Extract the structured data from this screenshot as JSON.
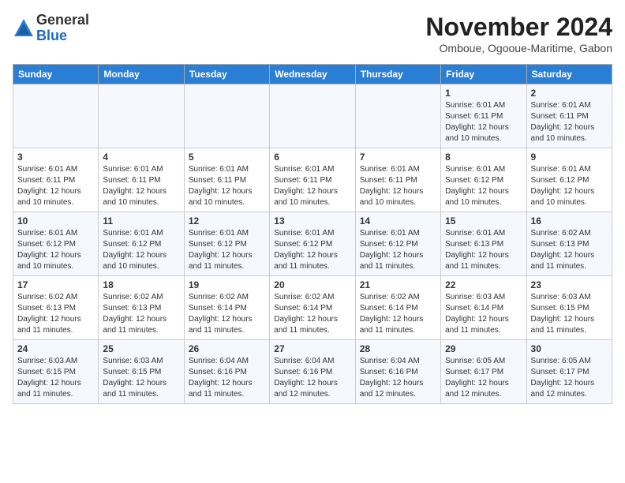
{
  "header": {
    "logo_line1": "General",
    "logo_line2": "Blue",
    "month_title": "November 2024",
    "subtitle": "Omboue, Ogooue-Maritime, Gabon"
  },
  "calendar": {
    "days_of_week": [
      "Sunday",
      "Monday",
      "Tuesday",
      "Wednesday",
      "Thursday",
      "Friday",
      "Saturday"
    ],
    "weeks": [
      [
        {
          "day": "",
          "info": ""
        },
        {
          "day": "",
          "info": ""
        },
        {
          "day": "",
          "info": ""
        },
        {
          "day": "",
          "info": ""
        },
        {
          "day": "",
          "info": ""
        },
        {
          "day": "1",
          "info": "Sunrise: 6:01 AM\nSunset: 6:11 PM\nDaylight: 12 hours\nand 10 minutes."
        },
        {
          "day": "2",
          "info": "Sunrise: 6:01 AM\nSunset: 6:11 PM\nDaylight: 12 hours\nand 10 minutes."
        }
      ],
      [
        {
          "day": "3",
          "info": "Sunrise: 6:01 AM\nSunset: 6:11 PM\nDaylight: 12 hours\nand 10 minutes."
        },
        {
          "day": "4",
          "info": "Sunrise: 6:01 AM\nSunset: 6:11 PM\nDaylight: 12 hours\nand 10 minutes."
        },
        {
          "day": "5",
          "info": "Sunrise: 6:01 AM\nSunset: 6:11 PM\nDaylight: 12 hours\nand 10 minutes."
        },
        {
          "day": "6",
          "info": "Sunrise: 6:01 AM\nSunset: 6:11 PM\nDaylight: 12 hours\nand 10 minutes."
        },
        {
          "day": "7",
          "info": "Sunrise: 6:01 AM\nSunset: 6:11 PM\nDaylight: 12 hours\nand 10 minutes."
        },
        {
          "day": "8",
          "info": "Sunrise: 6:01 AM\nSunset: 6:12 PM\nDaylight: 12 hours\nand 10 minutes."
        },
        {
          "day": "9",
          "info": "Sunrise: 6:01 AM\nSunset: 6:12 PM\nDaylight: 12 hours\nand 10 minutes."
        }
      ],
      [
        {
          "day": "10",
          "info": "Sunrise: 6:01 AM\nSunset: 6:12 PM\nDaylight: 12 hours\nand 10 minutes."
        },
        {
          "day": "11",
          "info": "Sunrise: 6:01 AM\nSunset: 6:12 PM\nDaylight: 12 hours\nand 10 minutes."
        },
        {
          "day": "12",
          "info": "Sunrise: 6:01 AM\nSunset: 6:12 PM\nDaylight: 12 hours\nand 11 minutes."
        },
        {
          "day": "13",
          "info": "Sunrise: 6:01 AM\nSunset: 6:12 PM\nDaylight: 12 hours\nand 11 minutes."
        },
        {
          "day": "14",
          "info": "Sunrise: 6:01 AM\nSunset: 6:12 PM\nDaylight: 12 hours\nand 11 minutes."
        },
        {
          "day": "15",
          "info": "Sunrise: 6:01 AM\nSunset: 6:13 PM\nDaylight: 12 hours\nand 11 minutes."
        },
        {
          "day": "16",
          "info": "Sunrise: 6:02 AM\nSunset: 6:13 PM\nDaylight: 12 hours\nand 11 minutes."
        }
      ],
      [
        {
          "day": "17",
          "info": "Sunrise: 6:02 AM\nSunset: 6:13 PM\nDaylight: 12 hours\nand 11 minutes."
        },
        {
          "day": "18",
          "info": "Sunrise: 6:02 AM\nSunset: 6:13 PM\nDaylight: 12 hours\nand 11 minutes."
        },
        {
          "day": "19",
          "info": "Sunrise: 6:02 AM\nSunset: 6:14 PM\nDaylight: 12 hours\nand 11 minutes."
        },
        {
          "day": "20",
          "info": "Sunrise: 6:02 AM\nSunset: 6:14 PM\nDaylight: 12 hours\nand 11 minutes."
        },
        {
          "day": "21",
          "info": "Sunrise: 6:02 AM\nSunset: 6:14 PM\nDaylight: 12 hours\nand 11 minutes."
        },
        {
          "day": "22",
          "info": "Sunrise: 6:03 AM\nSunset: 6:14 PM\nDaylight: 12 hours\nand 11 minutes."
        },
        {
          "day": "23",
          "info": "Sunrise: 6:03 AM\nSunset: 6:15 PM\nDaylight: 12 hours\nand 11 minutes."
        }
      ],
      [
        {
          "day": "24",
          "info": "Sunrise: 6:03 AM\nSunset: 6:15 PM\nDaylight: 12 hours\nand 11 minutes."
        },
        {
          "day": "25",
          "info": "Sunrise: 6:03 AM\nSunset: 6:15 PM\nDaylight: 12 hours\nand 11 minutes."
        },
        {
          "day": "26",
          "info": "Sunrise: 6:04 AM\nSunset: 6:16 PM\nDaylight: 12 hours\nand 11 minutes."
        },
        {
          "day": "27",
          "info": "Sunrise: 6:04 AM\nSunset: 6:16 PM\nDaylight: 12 hours\nand 12 minutes."
        },
        {
          "day": "28",
          "info": "Sunrise: 6:04 AM\nSunset: 6:16 PM\nDaylight: 12 hours\nand 12 minutes."
        },
        {
          "day": "29",
          "info": "Sunrise: 6:05 AM\nSunset: 6:17 PM\nDaylight: 12 hours\nand 12 minutes."
        },
        {
          "day": "30",
          "info": "Sunrise: 6:05 AM\nSunset: 6:17 PM\nDaylight: 12 hours\nand 12 minutes."
        }
      ]
    ]
  }
}
